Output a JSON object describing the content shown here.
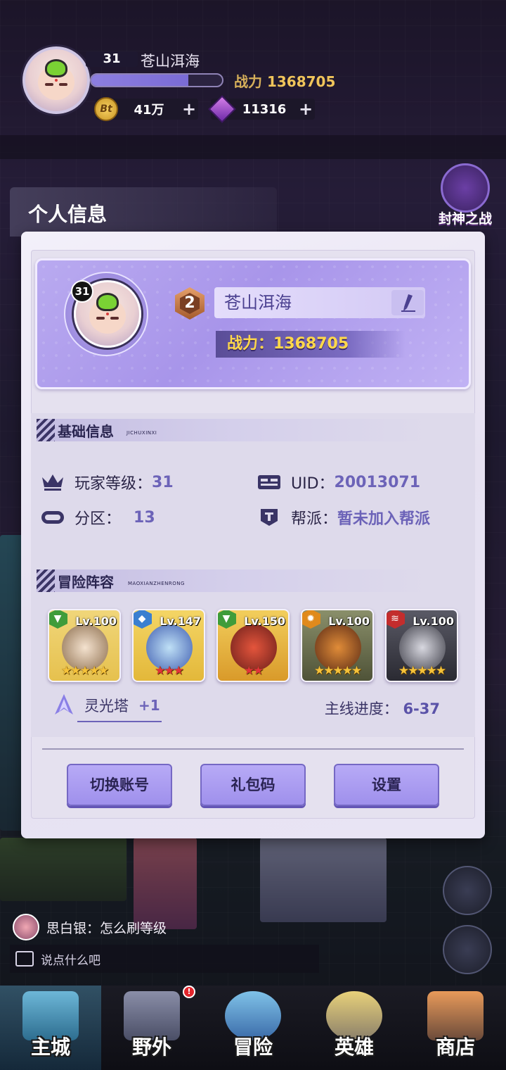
{
  "hud": {
    "level": "31",
    "name": "苍山洱海",
    "exp_fraction": 0.74,
    "power_label": "战力",
    "power_value": "1368705",
    "coin_icon_text": "Bt",
    "coin_value": "41万",
    "gem_value": "11316",
    "plus": "+"
  },
  "side_event": {
    "label": "封神之战"
  },
  "panel": {
    "title": "个人信息"
  },
  "profile": {
    "level": "31",
    "rank": "2",
    "name": "苍山洱海",
    "power_text": "战力：1368705"
  },
  "basic_info": {
    "title": "基础信息",
    "subtitle": "JICHUXINXI",
    "player_level_label": "玩家等级：",
    "player_level_value": "31",
    "uid_label": "UID：",
    "uid_value": "20013071",
    "zone_label": "分区：",
    "zone_value": "13",
    "guild_label": "帮派：",
    "guild_value": "暂未加入帮派"
  },
  "lineup": {
    "title": "冒险阵容",
    "subtitle": "MAOXIANZHENRONG",
    "heroes": [
      {
        "level": "Lv.100",
        "stars": "★★★★★",
        "element_color": "#3f9c3a",
        "star_color": "#f5c23a"
      },
      {
        "level": "Lv.147",
        "stars": "★★★",
        "element_color": "#3a7fd0",
        "star_color": "#e2323a"
      },
      {
        "level": "Lv.150",
        "stars": "★★",
        "element_color": "#3f9c3a",
        "star_color": "#e2323a"
      },
      {
        "level": "Lv.100",
        "stars": "★★★★★",
        "element_color": "#e08a1c",
        "star_color": "#f5c23a"
      },
      {
        "level": "Lv.100",
        "stars": "★★★★★",
        "element_color": "#c32d2d",
        "star_color": "#f5c23a"
      }
    ],
    "tower_label": "灵光塔",
    "tower_bonus": "+1",
    "progress_label": "主线进度：",
    "progress_value": "6-37"
  },
  "buttons": {
    "switch_account": "切换账号",
    "gift_code": "礼包码",
    "settings": "设置"
  },
  "chat": {
    "message": "思白银：怎么刷等级",
    "input_placeholder": "说点什么吧"
  },
  "nav": {
    "badge": "!",
    "items": [
      "主城",
      "野外",
      "冒险",
      "英雄",
      "商店"
    ]
  },
  "colors": {
    "accent": "#6c63b8",
    "power_gold": "#ffd84a",
    "card_purple": "#a895ea"
  }
}
